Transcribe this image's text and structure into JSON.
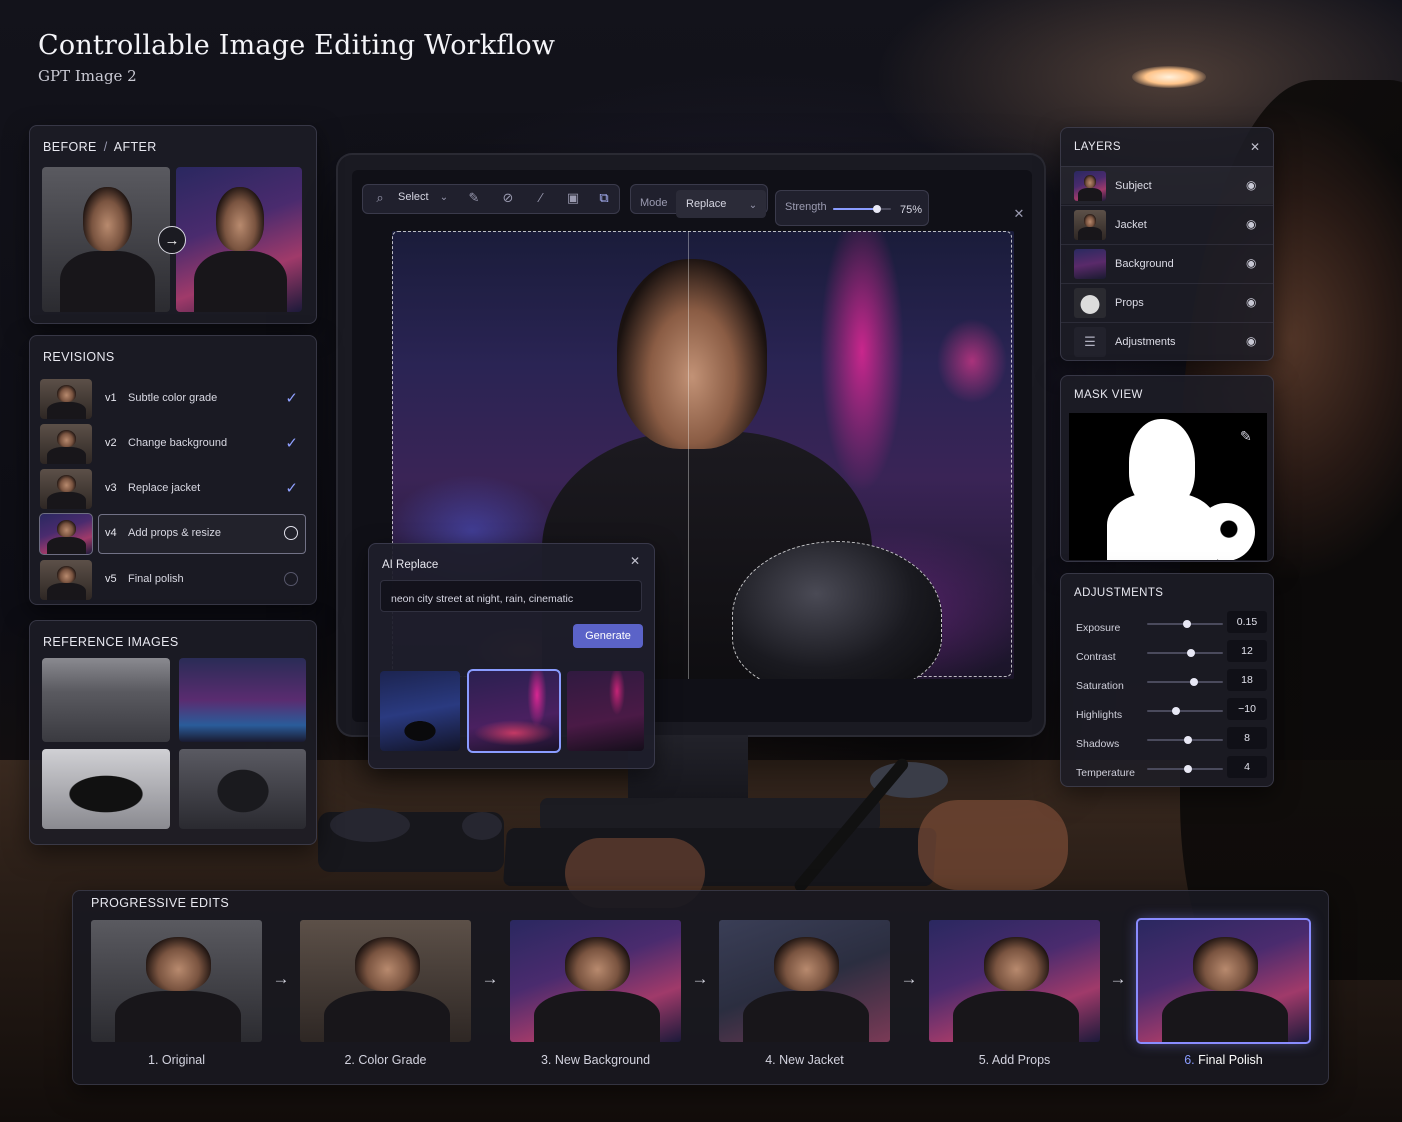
{
  "header": {
    "title": "Controllable Image Editing Workflow",
    "subtitle": "GPT Image 2"
  },
  "before_after": {
    "title_before": "BEFORE",
    "title_sep": "/",
    "title_after": "AFTER",
    "arrow_icon": "arrow-right-icon"
  },
  "revisions": {
    "title": "REVISIONS",
    "items": [
      {
        "version": "v1",
        "label": "Subtle color grade",
        "status": "done"
      },
      {
        "version": "v2",
        "label": "Change background",
        "status": "done"
      },
      {
        "version": "v3",
        "label": "Replace jacket",
        "status": "done"
      },
      {
        "version": "v4",
        "label": "Add props & resize",
        "status": "active"
      },
      {
        "version": "v5",
        "label": "Final polish",
        "status": "pending"
      }
    ]
  },
  "reference_images": {
    "title": "REFERENCE IMAGES",
    "items": [
      "city-street-photo",
      "neon-street-photo",
      "motorcycle-photo",
      "helmet-photo"
    ]
  },
  "toolbar": {
    "select_label": "Select",
    "mode_label": "Mode",
    "mode_value": "Replace",
    "strength_label": "Strength",
    "strength_value": "75%",
    "strength_fraction": 0.75,
    "tools": [
      "search-icon",
      "brush-icon",
      "lasso-icon",
      "eraser-icon",
      "mask-icon",
      "crop-select-icon"
    ]
  },
  "ai_replace": {
    "title": "AI Replace",
    "prompt": "neon city street at night, rain, cinematic",
    "generate_label": "Generate",
    "selected_option": 1
  },
  "layers": {
    "title": "LAYERS",
    "items": [
      {
        "name": "Subject"
      },
      {
        "name": "Jacket"
      },
      {
        "name": "Background"
      },
      {
        "name": "Props"
      },
      {
        "name": "Adjustments"
      }
    ]
  },
  "mask_view": {
    "title": "MASK VIEW",
    "edit_icon": "pencil-icon"
  },
  "adjustments": {
    "title": "ADJUSTMENTS",
    "items": [
      {
        "name": "Exposure",
        "value": "0.15",
        "level": 0.52
      },
      {
        "name": "Contrast",
        "value": "12",
        "level": 0.58
      },
      {
        "name": "Saturation",
        "value": "18",
        "level": 0.62
      },
      {
        "name": "Highlights",
        "value": "−10",
        "level": 0.38
      },
      {
        "name": "Shadows",
        "value": "8",
        "level": 0.54
      },
      {
        "name": "Temperature",
        "value": "4",
        "level": 0.54
      }
    ]
  },
  "progressive_edits": {
    "title": "PROGRESSIVE EDITS",
    "steps": [
      {
        "num": "1.",
        "label": "Original"
      },
      {
        "num": "2.",
        "label": "Color Grade"
      },
      {
        "num": "3.",
        "label": "New Background"
      },
      {
        "num": "4.",
        "label": "New Jacket"
      },
      {
        "num": "5.",
        "label": "Add Props"
      },
      {
        "num": "6.",
        "label": "Final Polish"
      }
    ],
    "selected_step": 5
  },
  "colors": {
    "accent": "#8a9cff",
    "button": "#5b63c8",
    "panel": "#1c1c26"
  }
}
